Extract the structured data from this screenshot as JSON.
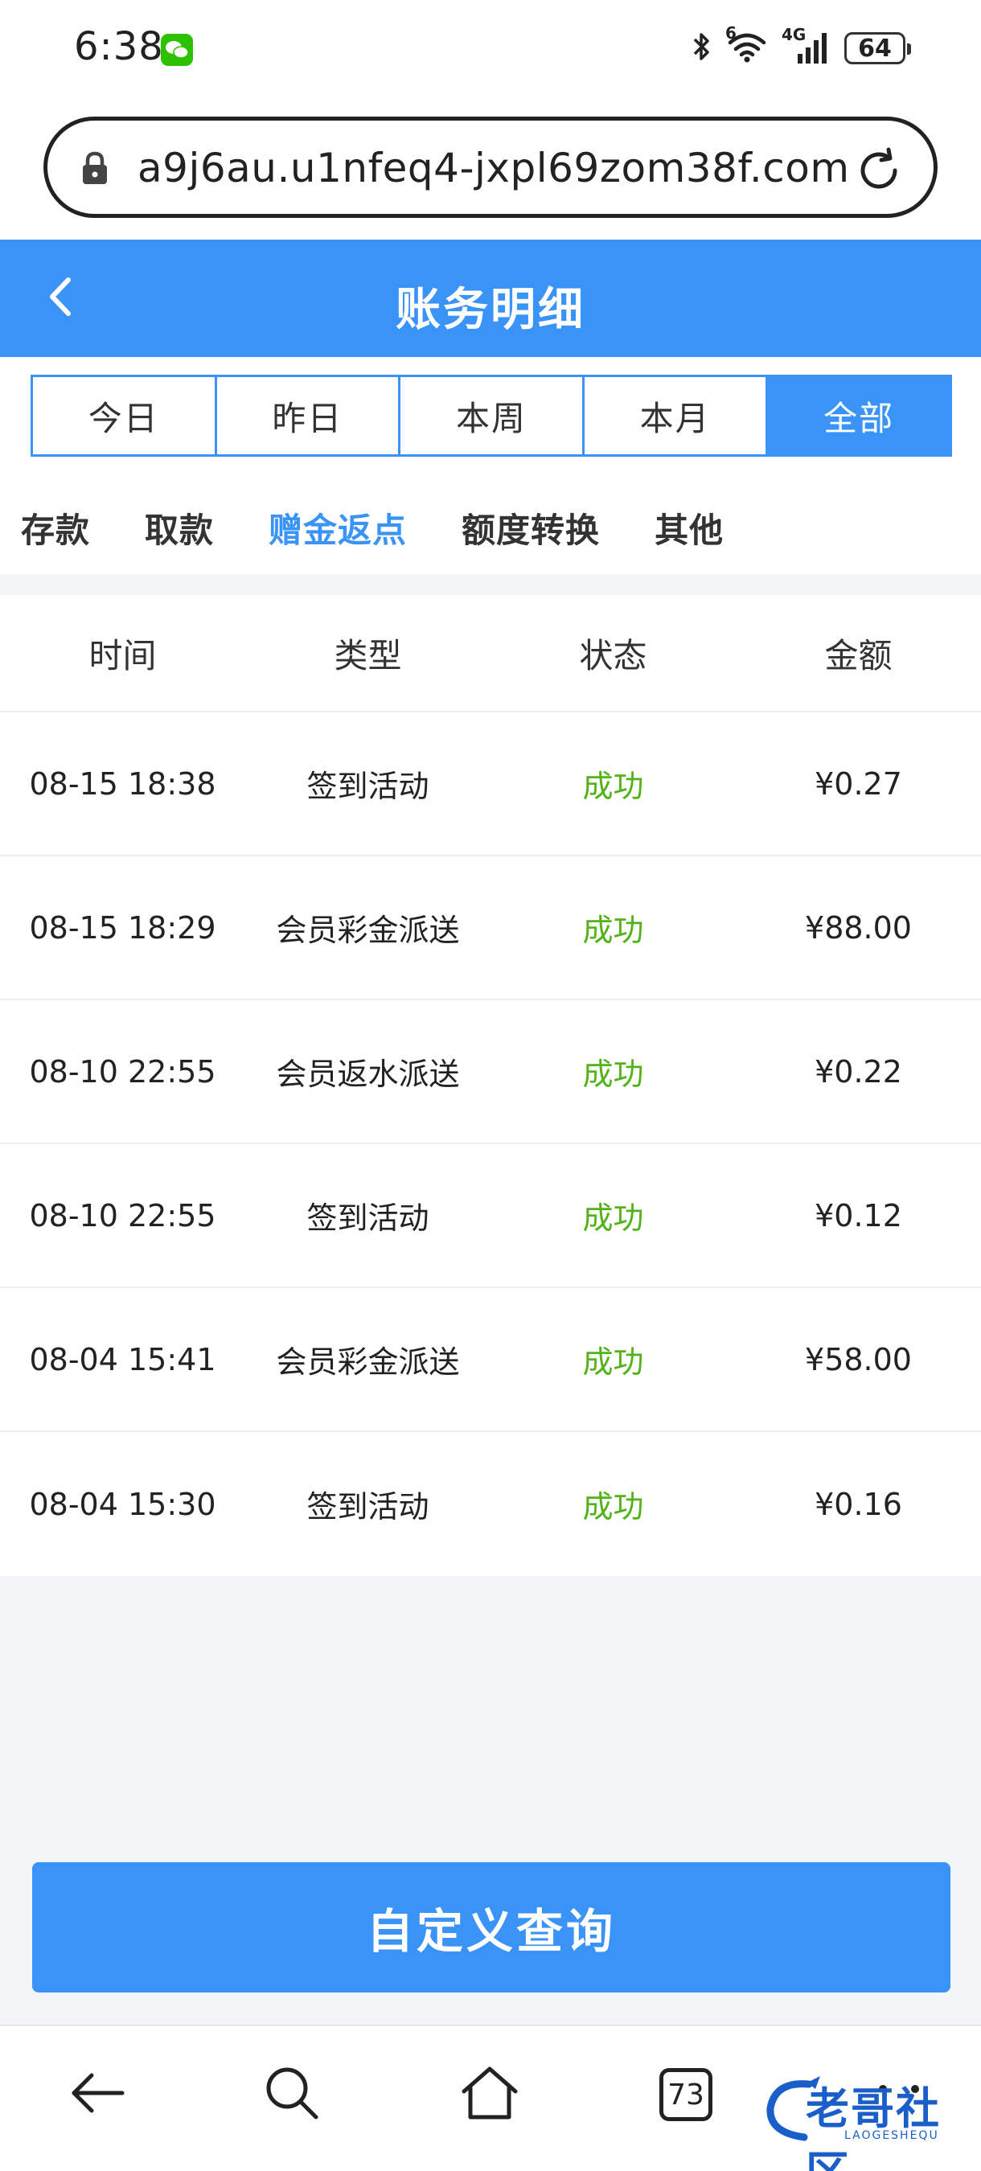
{
  "status_bar": {
    "time": "6:38",
    "signal_label": "4G",
    "wifi_label": "6",
    "battery": "64"
  },
  "browser": {
    "url": "a9j6au.u1nfeq4-jxpl69zom38f.com",
    "tab_count": "73"
  },
  "header": {
    "title": "账务明细"
  },
  "period_tabs": [
    {
      "label": "今日",
      "active": false
    },
    {
      "label": "昨日",
      "active": false
    },
    {
      "label": "本周",
      "active": false
    },
    {
      "label": "本月",
      "active": false
    },
    {
      "label": "全部",
      "active": true
    }
  ],
  "category_tabs": [
    {
      "label": "存款",
      "active": false
    },
    {
      "label": "取款",
      "active": false
    },
    {
      "label": "赠金返点",
      "active": true
    },
    {
      "label": "额度转换",
      "active": false
    },
    {
      "label": "其他",
      "active": false
    }
  ],
  "table": {
    "headers": [
      "时间",
      "类型",
      "状态",
      "金额"
    ],
    "rows": [
      {
        "time": "08-15 18:38",
        "type": "签到活动",
        "status": "成功",
        "amount": "¥0.27"
      },
      {
        "time": "08-15 18:29",
        "type": "会员彩金派送",
        "status": "成功",
        "amount": "¥88.00"
      },
      {
        "time": "08-10 22:55",
        "type": "会员返水派送",
        "status": "成功",
        "amount": "¥0.22"
      },
      {
        "time": "08-10 22:55",
        "type": "签到活动",
        "status": "成功",
        "amount": "¥0.12"
      },
      {
        "time": "08-04 15:41",
        "type": "会员彩金派送",
        "status": "成功",
        "amount": "¥58.00"
      },
      {
        "time": "08-04 15:30",
        "type": "签到活动",
        "status": "成功",
        "amount": "¥0.16"
      }
    ]
  },
  "query_button": {
    "label": "自定义查询"
  },
  "watermark": {
    "text": "老哥社区",
    "sub": "LAOGESHEQU"
  },
  "colors": {
    "primary": "#3a93f7",
    "success": "#52b318",
    "background": "#f4f5f7"
  }
}
